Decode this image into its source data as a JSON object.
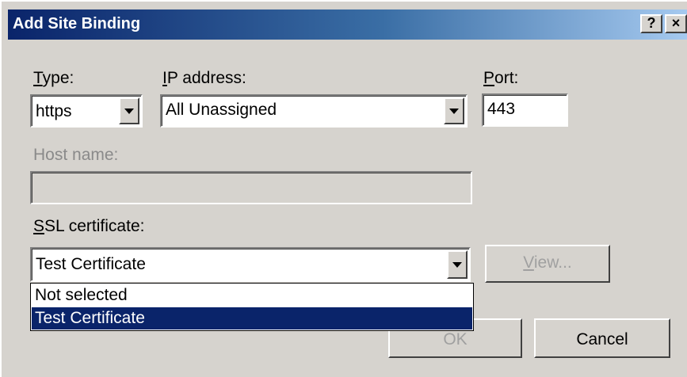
{
  "window": {
    "title": "Add Site Binding",
    "help_button": "?",
    "close_button": "×"
  },
  "type": {
    "label_prefix": "T",
    "label_rest": "ype:",
    "value": "https"
  },
  "ip_address": {
    "label_prefix": "I",
    "label_rest": "P address:",
    "value": "All Unassigned"
  },
  "port": {
    "label_prefix": "P",
    "label_rest": "ort:",
    "value": "443"
  },
  "host_name": {
    "label": "Host name:",
    "value": ""
  },
  "ssl_certificate": {
    "label_prefix": "S",
    "label_rest": "SL certificate:",
    "value": "Test Certificate",
    "options": [
      "Not selected",
      "Test Certificate"
    ],
    "selected_index": 1
  },
  "buttons": {
    "view_prefix": "V",
    "view_rest": "iew...",
    "ok": "OK",
    "cancel": "Cancel"
  },
  "colors": {
    "title_gradient_start": "#0a246a",
    "title_gradient_end": "#a6caf0",
    "dialog_bg": "#d6d3ce",
    "selection_bg": "#0a246a"
  }
}
